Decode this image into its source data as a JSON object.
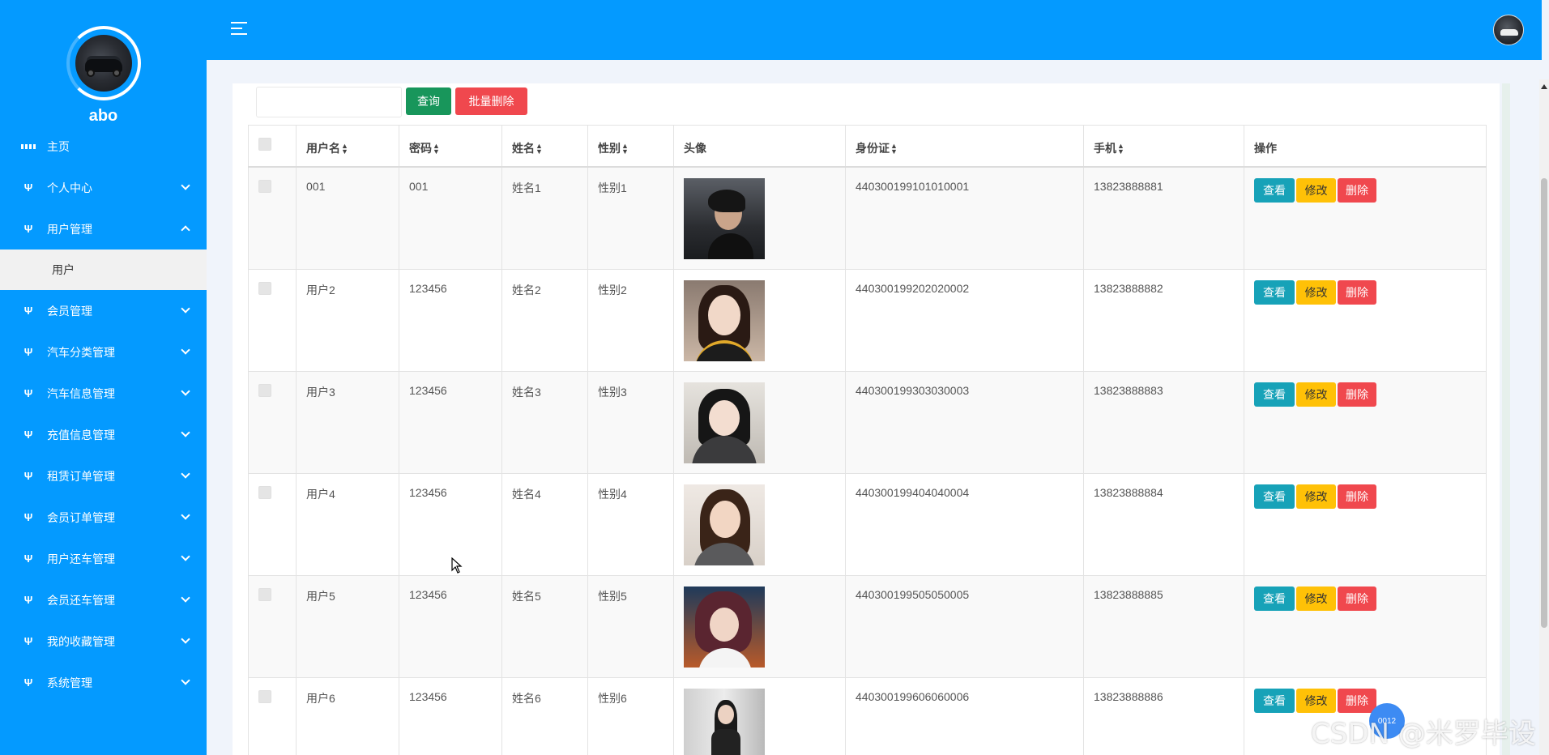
{
  "sidebar": {
    "username": "abo",
    "items": [
      {
        "label": "主页",
        "icon": "grid-icon",
        "expandable": false
      },
      {
        "label": "个人中心",
        "icon": "stethoscope-icon",
        "expandable": true
      },
      {
        "label": "用户管理",
        "icon": "stethoscope-icon",
        "expandable": true,
        "expanded": true,
        "children": [
          {
            "label": "用户"
          }
        ]
      },
      {
        "label": "会员管理",
        "icon": "stethoscope-icon",
        "expandable": true
      },
      {
        "label": "汽车分类管理",
        "icon": "stethoscope-icon",
        "expandable": true
      },
      {
        "label": "汽车信息管理",
        "icon": "stethoscope-icon",
        "expandable": true
      },
      {
        "label": "充值信息管理",
        "icon": "stethoscope-icon",
        "expandable": true
      },
      {
        "label": "租赁订单管理",
        "icon": "stethoscope-icon",
        "expandable": true
      },
      {
        "label": "会员订单管理",
        "icon": "stethoscope-icon",
        "expandable": true
      },
      {
        "label": "用户还车管理",
        "icon": "stethoscope-icon",
        "expandable": true
      },
      {
        "label": "会员还车管理",
        "icon": "stethoscope-icon",
        "expandable": true
      },
      {
        "label": "我的收藏管理",
        "icon": "stethoscope-icon",
        "expandable": true
      },
      {
        "label": "系统管理",
        "icon": "stethoscope-icon",
        "expandable": true
      }
    ]
  },
  "toolbar": {
    "search_value": "",
    "query_label": "查询",
    "batch_delete_label": "批量删除"
  },
  "table": {
    "columns": [
      "用户名",
      "密码",
      "姓名",
      "性别",
      "头像",
      "身份证",
      "手机",
      "操作"
    ],
    "sortable": [
      true,
      true,
      true,
      true,
      false,
      true,
      true,
      false
    ],
    "rows": [
      {
        "username": "001",
        "password": "001",
        "name": "姓名1",
        "gender": "性别1",
        "id_card": "440300199101010001",
        "phone": "13823888881"
      },
      {
        "username": "用户2",
        "password": "123456",
        "name": "姓名2",
        "gender": "性别2",
        "id_card": "440300199202020002",
        "phone": "13823888882"
      },
      {
        "username": "用户3",
        "password": "123456",
        "name": "姓名3",
        "gender": "性别3",
        "id_card": "440300199303030003",
        "phone": "13823888883"
      },
      {
        "username": "用户4",
        "password": "123456",
        "name": "姓名4",
        "gender": "性别4",
        "id_card": "440300199404040004",
        "phone": "13823888884"
      },
      {
        "username": "用户5",
        "password": "123456",
        "name": "姓名5",
        "gender": "性别5",
        "id_card": "440300199505050005",
        "phone": "13823888885"
      },
      {
        "username": "用户6",
        "password": "123456",
        "name": "姓名6",
        "gender": "性别6",
        "id_card": "440300199606060006",
        "phone": "13823888886"
      }
    ],
    "actions": {
      "view": "查看",
      "edit": "修改",
      "delete": "删除"
    }
  },
  "float_widget": {
    "label": "0012"
  },
  "watermark": "CSDN @米罗毕设",
  "colors": {
    "primary": "#049aff",
    "query_button": "#18965b",
    "delete_button": "#f0484e",
    "view_button": "#17a2b8",
    "edit_button": "#ffc107"
  }
}
